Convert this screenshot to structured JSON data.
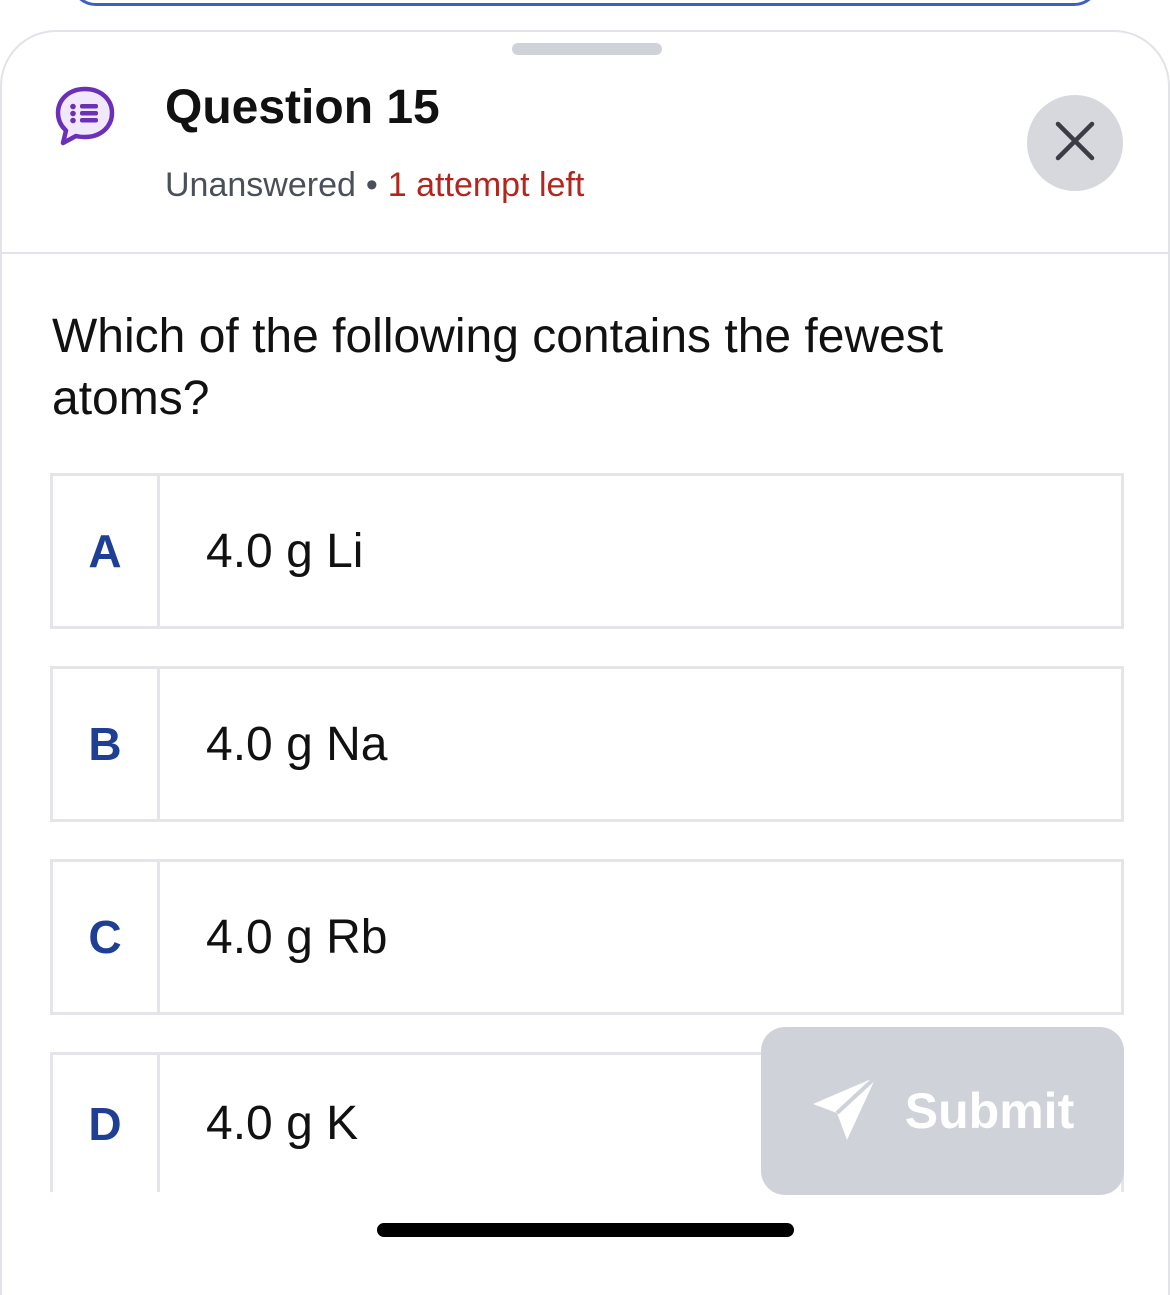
{
  "header": {
    "title": "Question 15",
    "status": "Unanswered",
    "separator": "•",
    "attempts": "1 attempt left",
    "icon": "question-list-icon",
    "close_icon": "close-icon"
  },
  "question": {
    "text": "Which of the following contains the fewest atoms?"
  },
  "options": [
    {
      "letter": "A",
      "text": "4.0 g Li"
    },
    {
      "letter": "B",
      "text": "4.0 g Na"
    },
    {
      "letter": "C",
      "text": "4.0 g Rb"
    },
    {
      "letter": "D",
      "text": "4.0 g K"
    }
  ],
  "submit": {
    "label": "Submit",
    "icon": "send-icon",
    "enabled": false
  },
  "colors": {
    "accent": "#1f3f95",
    "attempts": "#b3261e",
    "icon_purple": "#6b2fb8",
    "disabled_button": "#cfd2d9"
  }
}
